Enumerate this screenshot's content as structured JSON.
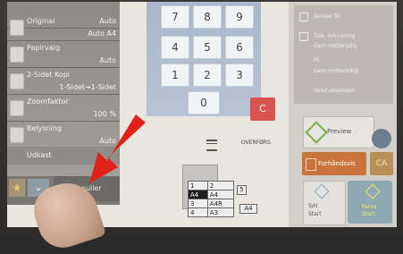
{
  "left_panel": {
    "rows": [
      {
        "label": "",
        "value": "Auto"
      },
      {
        "label": "Original",
        "value": "Auto A4"
      },
      {
        "label": "Papirvalg",
        "value": "Auto"
      },
      {
        "label": "2-Sidet Kopi",
        "value": "1-Sidet→1-Sidet"
      },
      {
        "label": "Zoomfaktor",
        "value": "100 %"
      },
      {
        "label": "Belysning",
        "value": "Auto"
      }
    ],
    "udkast_label": "Udkast",
    "annuller_label": "Annuller"
  },
  "keypad": {
    "keys": [
      "7",
      "8",
      "9",
      "4",
      "5",
      "6",
      "1",
      "2",
      "3",
      "0"
    ],
    "clear_label": "C"
  },
  "right_panel": {
    "lines": [
      "Sender fil",
      "Dok. Arkivering",
      "Gem midlertidig",
      "Fil",
      "Gem midlertidigt",
      "Send eksempel"
    ],
    "preview_label": "Preview",
    "forhandsvis_label": "Forhåndsvis",
    "ca_label": "CA",
    "sh_label_1": "S/H",
    "sh_label_2": "Start",
    "farve_label_1": "Farve",
    "farve_label_2": "Start"
  },
  "status": {
    "overfor_label": "OVERFØRS",
    "tray_rows": [
      [
        "1",
        "2",
        "",
        ""
      ],
      [
        "A4",
        "",
        "A4",
        ""
      ],
      [
        "3",
        "A4R",
        "",
        ""
      ],
      [
        "4",
        "A3",
        "",
        "A4"
      ]
    ],
    "side_tray_label": "5"
  },
  "colors": {
    "clear_key": "#d9534f",
    "arrow": "#e3211b",
    "forhandsvis": "#c9743d"
  }
}
